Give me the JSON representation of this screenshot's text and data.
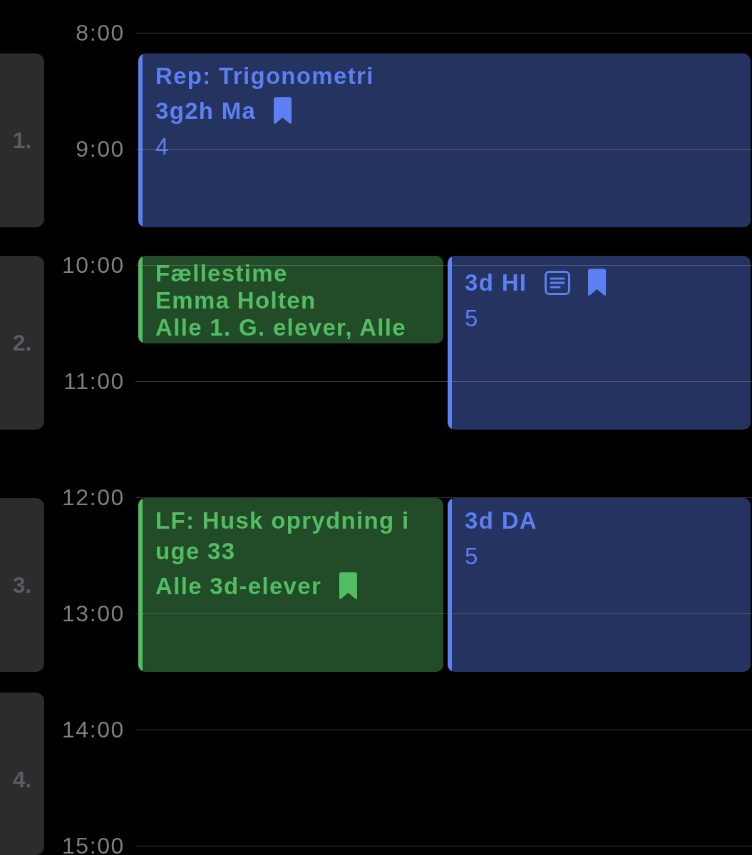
{
  "hours": [
    "8:00",
    "9:00",
    "10:00",
    "11:00",
    "12:00",
    "13:00",
    "14:00",
    "15:00"
  ],
  "periods": [
    {
      "label": "1.",
      "events": [
        {
          "color": "#5c7ff2",
          "lines": [
            {
              "kind": "heading",
              "text": "Rep: Trigonometri"
            },
            {
              "kind": "heading",
              "text": "3g2h Ma",
              "icons": [
                {
                  "kind": "bookmark"
                }
              ]
            },
            {
              "kind": "plain",
              "text": "4"
            }
          ]
        }
      ]
    },
    {
      "label": "2.",
      "events": [
        {
          "color": "#52bd62",
          "lines": [
            {
              "kind": "heading",
              "text": "Fællestime"
            },
            {
              "kind": "heading",
              "text": "Emma Holten"
            },
            {
              "kind": "heading",
              "text": "Alle 1. G. elever, Alle"
            }
          ]
        },
        {
          "color": "#5c7ff2",
          "lines": [
            {
              "kind": "heading",
              "text": "3d HI",
              "icons": [
                {
                  "kind": "note"
                },
                {
                  "kind": "bookmark"
                }
              ]
            },
            {
              "kind": "plain",
              "text": "5"
            }
          ]
        }
      ]
    },
    {
      "label": "3.",
      "events": [
        {
          "color": "#52bd62",
          "lines": [
            {
              "kind": "heading",
              "text": "LF: Husk oprydning i uge 33"
            },
            {
              "kind": "heading",
              "text": "Alle 3d-elever",
              "icons": [
                {
                  "kind": "bookmark"
                }
              ]
            }
          ]
        },
        {
          "color": "#5c7ff2",
          "lines": [
            {
              "kind": "heading",
              "text": "3d DA"
            },
            {
              "kind": "plain",
              "text": "5"
            }
          ]
        }
      ]
    },
    {
      "label": "4."
    }
  ]
}
